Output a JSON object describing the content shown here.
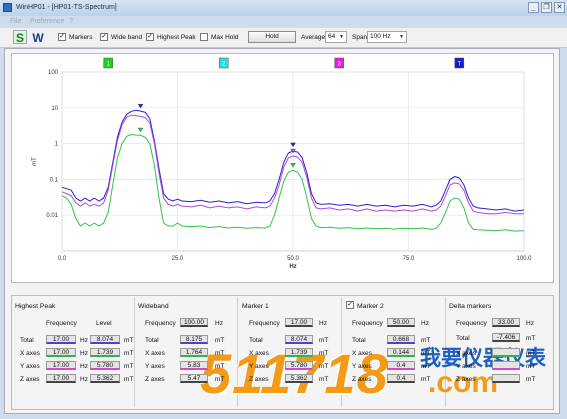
{
  "window": {
    "title": "WinHP01 - [HP01-TS-Spectrum]",
    "minimize_glyph": "_",
    "restore_glyph": "❐",
    "close_glyph": "✕"
  },
  "menu": [
    "File",
    "Preference",
    "?"
  ],
  "toolbar": {
    "s_label": "S",
    "w_label": "W",
    "markers_label": "Markers",
    "wideband_label": "Wide band",
    "highest_peak_label": "Highest Peak",
    "max_hold_label": "Max Hold",
    "hold_label": "Hold",
    "average_label": "Average",
    "average_value": "64",
    "span_label": "Span",
    "span_value": "100 Hz",
    "check_glyph": "✓"
  },
  "colors": {
    "blue": "#2a1fd8",
    "purple": "#b048d8",
    "green": "#2ec44a",
    "marker1": "#22cc22",
    "marker2": "#22e0e0",
    "marker3": "#e020e0",
    "marker4": "#1a1ac8",
    "accent_orange": "#f39a16",
    "accent_blue": "#1e5fbf"
  },
  "chart_data": {
    "type": "line",
    "ylabel": "mT",
    "xlabel": "Hz",
    "x_ticks": [
      "0.0",
      "25.0",
      "50.0",
      "75.0",
      "100.0"
    ],
    "y_ticks": [
      "100",
      "10",
      "1",
      "0.1",
      "0.01"
    ],
    "xlim": [
      0,
      100
    ],
    "ylim_log": [
      0.001,
      100
    ],
    "y_scale": "log",
    "grid": true,
    "marker_flags": [
      {
        "label": "1",
        "x": 10,
        "color": "#22cc22"
      },
      {
        "label": "2",
        "x": 35,
        "color": "#22e0e0"
      },
      {
        "label": "3",
        "x": 60,
        "color": "#e020e0"
      },
      {
        "label": "T",
        "x": 86,
        "color": "#1a1ac8"
      }
    ],
    "series": [
      {
        "color": "#2a1fd8",
        "x": [
          0,
          1,
          2,
          3,
          4,
          5,
          6,
          7,
          8,
          9,
          10,
          11,
          12,
          13,
          14,
          15,
          16,
          17,
          18,
          19,
          20,
          21,
          22,
          23,
          24,
          25,
          26,
          28,
          30,
          32,
          34,
          36,
          38,
          40,
          42,
          44,
          45,
          46,
          47,
          48,
          49,
          50,
          51,
          52,
          53,
          54,
          55,
          56,
          58,
          60,
          62,
          64,
          66,
          68,
          70,
          72,
          74,
          76,
          78,
          80,
          81,
          82,
          83,
          84,
          85,
          86,
          87,
          88,
          89,
          90,
          92,
          94,
          96,
          98,
          100
        ],
        "y": [
          0.06,
          0.055,
          0.05,
          0.03,
          0.025,
          0.03,
          0.025,
          0.03,
          0.025,
          0.03,
          0.06,
          0.3,
          1.5,
          4.0,
          6.5,
          8.0,
          8.5,
          8.07,
          7.5,
          5.0,
          1.2,
          0.2,
          0.04,
          0.028,
          0.025,
          0.028,
          0.025,
          0.024,
          0.026,
          0.023,
          0.025,
          0.022,
          0.024,
          0.021,
          0.023,
          0.022,
          0.025,
          0.04,
          0.1,
          0.3,
          0.55,
          0.62,
          0.58,
          0.4,
          0.15,
          0.04,
          0.022,
          0.02,
          0.021,
          0.019,
          0.02,
          0.018,
          0.02,
          0.018,
          0.019,
          0.017,
          0.019,
          0.018,
          0.02,
          0.017,
          0.019,
          0.025,
          0.05,
          0.1,
          0.12,
          0.11,
          0.07,
          0.03,
          0.018,
          0.016,
          0.015,
          0.014,
          0.015,
          0.013,
          0.014
        ]
      },
      {
        "color": "#b048d8",
        "x": [
          0,
          1,
          2,
          3,
          4,
          5,
          6,
          7,
          8,
          9,
          10,
          11,
          12,
          13,
          14,
          15,
          16,
          17,
          18,
          19,
          20,
          21,
          22,
          23,
          24,
          25,
          26,
          28,
          30,
          32,
          34,
          36,
          38,
          40,
          42,
          44,
          45,
          46,
          47,
          48,
          49,
          50,
          51,
          52,
          53,
          54,
          55,
          56,
          58,
          60,
          62,
          64,
          66,
          68,
          70,
          72,
          74,
          76,
          78,
          80,
          81,
          82,
          83,
          84,
          85,
          86,
          87,
          88,
          89,
          90,
          92,
          94,
          96,
          98,
          100
        ],
        "y": [
          0.045,
          0.04,
          0.035,
          0.022,
          0.018,
          0.022,
          0.018,
          0.02,
          0.018,
          0.022,
          0.05,
          0.25,
          1.2,
          3.4,
          5.5,
          6.2,
          6.0,
          5.78,
          5.3,
          3.8,
          1.0,
          0.15,
          0.03,
          0.02,
          0.018,
          0.02,
          0.018,
          0.017,
          0.019,
          0.016,
          0.018,
          0.016,
          0.017,
          0.015,
          0.017,
          0.016,
          0.018,
          0.03,
          0.07,
          0.22,
          0.4,
          0.45,
          0.42,
          0.3,
          0.11,
          0.03,
          0.016,
          0.015,
          0.016,
          0.014,
          0.015,
          0.013,
          0.015,
          0.013,
          0.014,
          0.013,
          0.014,
          0.013,
          0.015,
          0.013,
          0.014,
          0.018,
          0.035,
          0.07,
          0.08,
          0.075,
          0.05,
          0.022,
          0.013,
          0.012,
          0.011,
          0.011,
          0.012,
          0.011,
          0.011
        ]
      },
      {
        "color": "#2ec44a",
        "x": [
          0,
          1,
          2,
          3,
          4,
          5,
          6,
          7,
          8,
          9,
          10,
          11,
          12,
          13,
          14,
          15,
          16,
          17,
          18,
          19,
          20,
          21,
          22,
          23,
          24,
          25,
          26,
          28,
          30,
          32,
          34,
          36,
          38,
          40,
          42,
          44,
          45,
          46,
          47,
          48,
          49,
          50,
          51,
          52,
          53,
          54,
          55,
          56,
          58,
          60,
          62,
          64,
          66,
          68,
          70,
          72,
          74,
          76,
          78,
          80,
          81,
          82,
          83,
          84,
          85,
          86,
          87,
          88,
          89,
          90,
          92,
          94,
          96,
          98,
          100
        ],
        "y": [
          0.035,
          0.03,
          0.02,
          0.008,
          0.005,
          0.006,
          0.005,
          0.006,
          0.005,
          0.006,
          0.012,
          0.07,
          0.4,
          1.0,
          1.6,
          1.8,
          1.74,
          1.7,
          1.5,
          1.0,
          0.25,
          0.03,
          0.006,
          0.005,
          0.005,
          0.006,
          0.005,
          0.0048,
          0.005,
          0.0045,
          0.0048,
          0.0044,
          0.0046,
          0.0043,
          0.0045,
          0.0044,
          0.005,
          0.01,
          0.03,
          0.09,
          0.16,
          0.18,
          0.16,
          0.1,
          0.03,
          0.008,
          0.005,
          0.0045,
          0.0046,
          0.0043,
          0.0045,
          0.0042,
          0.0044,
          0.0042,
          0.0043,
          0.0041,
          0.0043,
          0.0042,
          0.0044,
          0.004,
          0.0043,
          0.006,
          0.012,
          0.025,
          0.03,
          0.028,
          0.016,
          0.006,
          0.004,
          0.0039,
          0.0038,
          0.0037,
          0.0039,
          0.0036,
          0.0037
        ]
      }
    ],
    "peak_markers": [
      {
        "x": 17,
        "y": 8.07,
        "color": "#2a1fd8"
      },
      {
        "x": 17,
        "y": 1.739,
        "color": "#2ec44a"
      },
      {
        "x": 50,
        "y": 0.668,
        "color": "#2a1fd8"
      },
      {
        "x": 50,
        "y": 0.45,
        "color": "#b048d8"
      },
      {
        "x": 50,
        "y": 0.18,
        "color": "#2ec44a"
      }
    ]
  },
  "panels": {
    "highest_peak": {
      "title": "Highest Peak",
      "freq_header": "Frequency",
      "level_header": "Level",
      "rows": [
        {
          "label": "Total",
          "freq": "17.00",
          "hz": "Hz",
          "level": "8.074",
          "unit": "mT"
        },
        {
          "label": "X axes",
          "freq": "17.00",
          "hz": "Hz",
          "level": "1.739",
          "unit": "mT"
        },
        {
          "label": "Y axes",
          "freq": "17.00",
          "hz": "Hz",
          "level": "5.780",
          "unit": "mT"
        },
        {
          "label": "Z axes",
          "freq": "17.00",
          "hz": "Hz",
          "level": "5.362",
          "unit": "mT"
        }
      ]
    },
    "wideband": {
      "title": "Wideband",
      "freq_label": "Frequency",
      "freq_value": "100.00",
      "freq_unit": "Hz",
      "rows": [
        {
          "label": "Total",
          "value": "8.175",
          "unit": "mT"
        },
        {
          "label": "X axes",
          "value": "1.764",
          "unit": "mT"
        },
        {
          "label": "Y axes",
          "value": "5.83",
          "unit": "mT"
        },
        {
          "label": "Z axes",
          "value": "5.47",
          "unit": "mT"
        }
      ]
    },
    "marker1": {
      "title": "Marker 1",
      "freq_label": "Frequency",
      "freq_value": "17.00",
      "freq_unit": "Hz",
      "rows": [
        {
          "label": "Total",
          "value": "8.074",
          "unit": "mT"
        },
        {
          "label": "X axes",
          "value": "1.739",
          "unit": "mT"
        },
        {
          "label": "Y axes",
          "value": "5.780",
          "unit": "mT"
        },
        {
          "label": "Z axes",
          "value": "5.362",
          "unit": "mT"
        }
      ]
    },
    "marker2": {
      "title": "Marker 2",
      "freq_label": "Frequency",
      "freq_value": "50.00",
      "freq_unit": "Hz",
      "rows": [
        {
          "label": "Total",
          "value": "0.668",
          "unit": "mT"
        },
        {
          "label": "X axes",
          "value": "0.144",
          "unit": "mT"
        },
        {
          "label": "Y axes",
          "value": "0.4",
          "unit": "mT"
        },
        {
          "label": "Z axes",
          "value": "0.4",
          "unit": "mT"
        }
      ]
    },
    "delta": {
      "title": "Delta markers",
      "freq_label": "Frequency",
      "freq_value": "33.00",
      "freq_unit": "Hz",
      "total_label": "Total",
      "total_value": "-7.406",
      "total_unit": "mT",
      "rows": [
        {
          "label": "X axes",
          "value": "",
          "unit": "mT"
        },
        {
          "label": "Y axes",
          "value": "",
          "unit": "mT"
        },
        {
          "label": "Z axes",
          "value": "",
          "unit": "mT"
        }
      ]
    }
  },
  "watermark": {
    "digits": "511718",
    "chinese": "我要仪器仪表",
    "dotcom": ".com"
  }
}
